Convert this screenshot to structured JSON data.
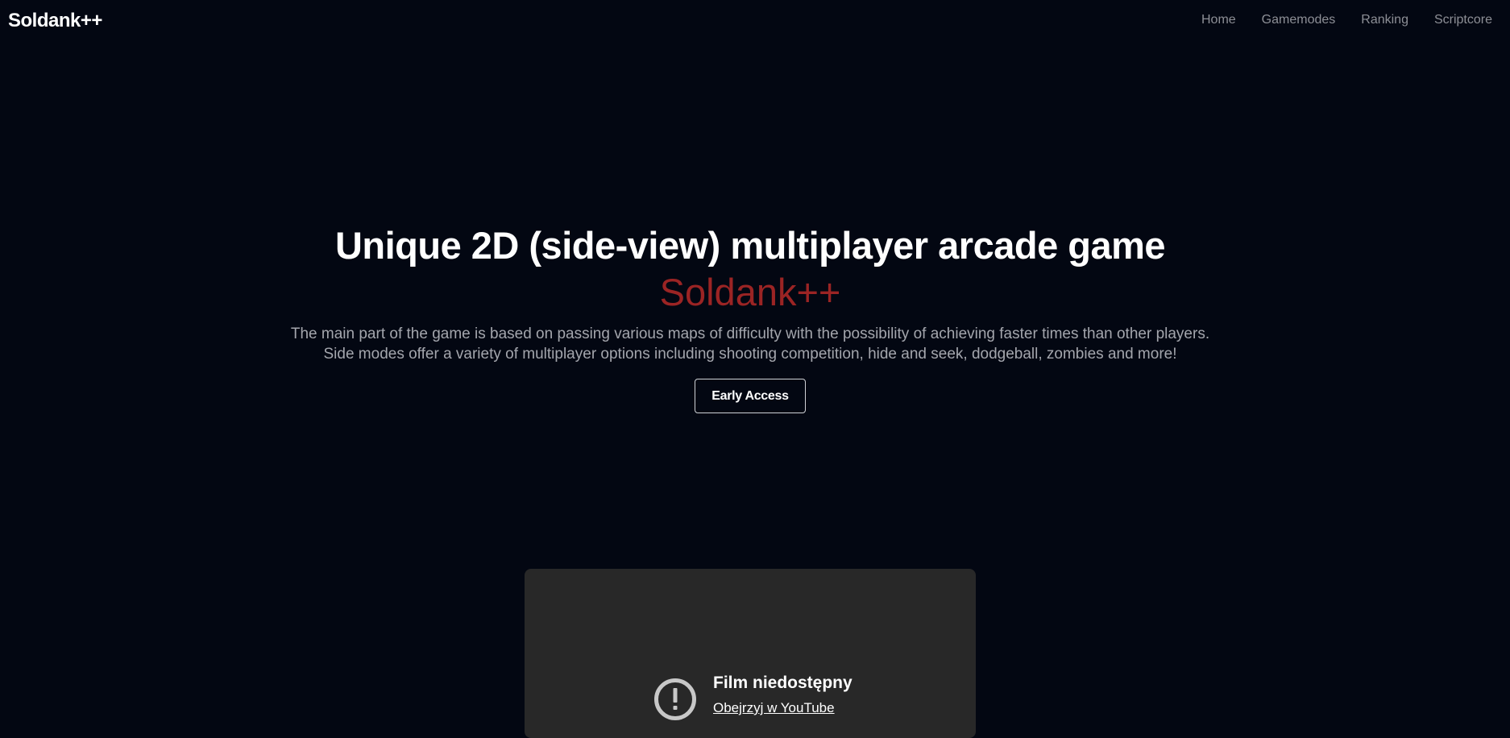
{
  "navbar": {
    "brand": "Soldank++",
    "links": [
      "Home",
      "Gamemodes",
      "Ranking",
      "Scriptcore"
    ]
  },
  "hero": {
    "title": "Unique 2D (side-view) multiplayer arcade game",
    "subtitle": "Soldank++",
    "description_line1": "The main part of the game is based on passing various maps of difficulty with the possibility of achieving faster times than other players.",
    "description_line2": "Side modes offer a variety of multiplayer options including shooting competition, hide and seek, dodgeball, zombies and more!",
    "cta_label": "Early Access"
  },
  "video": {
    "icon": "alert-circle-icon",
    "error_title": "Film niedostępny",
    "error_link": "Obejrzyj w YouTube"
  },
  "colors": {
    "background": "#030712",
    "accent": "#9b2424",
    "nav_text": "#8d8f96",
    "video_bg": "#282828"
  }
}
